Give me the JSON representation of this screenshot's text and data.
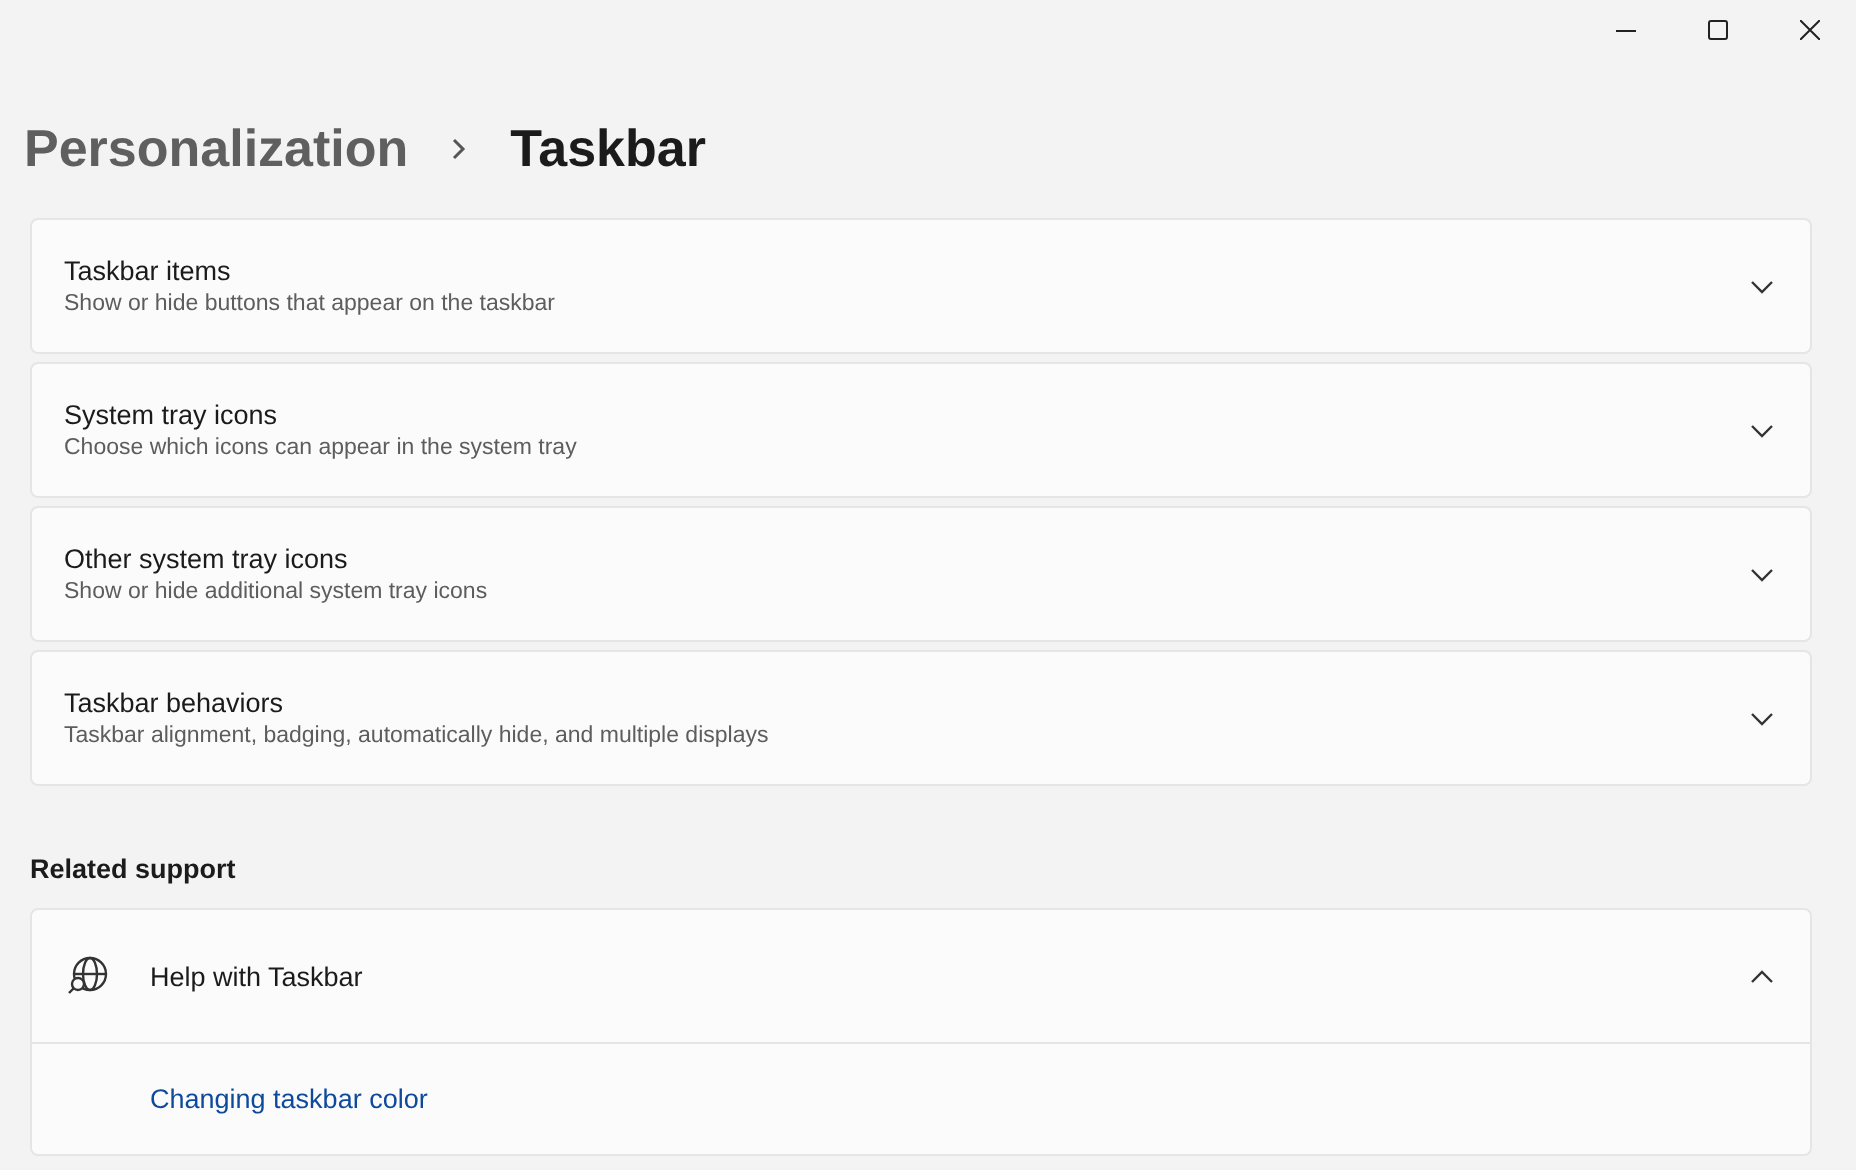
{
  "breadcrumb": [
    {
      "label": "Personalization",
      "current": false
    },
    {
      "label": "Taskbar",
      "current": true
    }
  ],
  "settings": [
    {
      "title": "Taskbar items",
      "description": "Show or hide buttons that appear on the taskbar",
      "expanded": false
    },
    {
      "title": "System tray icons",
      "description": "Choose which icons can appear in the system tray",
      "expanded": false
    },
    {
      "title": "Other system tray icons",
      "description": "Show or hide additional system tray icons",
      "expanded": false
    },
    {
      "title": "Taskbar behaviors",
      "description": "Taskbar alignment, badging, automatically hide, and multiple displays",
      "expanded": false
    }
  ],
  "related_support": {
    "heading": "Related support",
    "title": "Help with Taskbar",
    "expanded": true,
    "links": [
      "Changing taskbar color"
    ]
  }
}
